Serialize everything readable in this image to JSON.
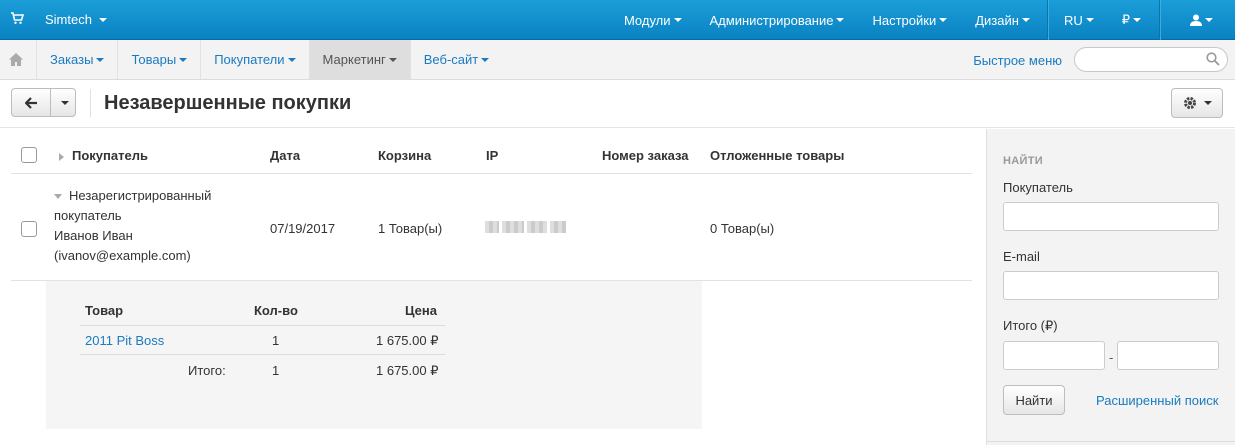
{
  "topbar": {
    "brand": "Simtech",
    "menu": [
      "Модули",
      "Администрирование",
      "Настройки",
      "Дизайн"
    ],
    "lang": "RU",
    "currency": "₽"
  },
  "secbar": {
    "tabs": [
      "Заказы",
      "Товары",
      "Покупатели",
      "Маркетинг",
      "Веб-сайт"
    ],
    "active_tab": "Маркетинг",
    "quick_menu": "Быстрое меню",
    "search_placeholder": ""
  },
  "page": {
    "title": "Незавершенные покупки"
  },
  "table": {
    "headers": {
      "customer": "Покупатель",
      "date": "Дата",
      "cart": "Корзина",
      "ip": "IP",
      "order": "Номер заказа",
      "wishlist": "Отложенные товары"
    },
    "rows": [
      {
        "customer_lines": [
          "Незарегистрированный",
          "покупатель",
          "Иванов Иван",
          "(ivanov@example.com)"
        ],
        "date": "07/19/2017",
        "cart": "1 Товар(ы)",
        "order": "",
        "wishlist": "0 Товар(ы)"
      }
    ]
  },
  "detail": {
    "headers": {
      "product": "Товар",
      "qty": "Кол-во",
      "price": "Цена"
    },
    "items": [
      {
        "product": "2011 Pit Boss",
        "qty": "1",
        "price": "1 675.00 ₽"
      }
    ],
    "total": {
      "label": "Итого:",
      "qty": "1",
      "price": "1 675.00 ₽"
    }
  },
  "sidebar": {
    "title": "НАЙТИ",
    "customer_label": "Покупатель",
    "email_label": "E-mail",
    "total_label": "Итого (₽)",
    "range_sep": "-",
    "find_button": "Найти",
    "advanced_link": "Расширенный поиск"
  }
}
